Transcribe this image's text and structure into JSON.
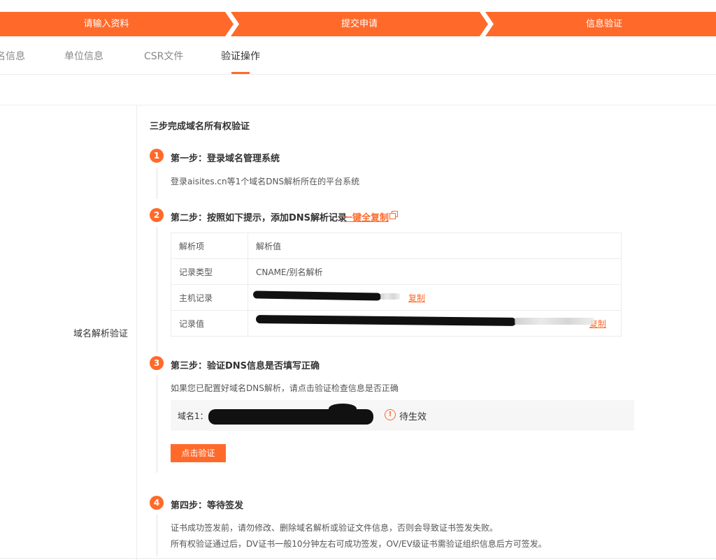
{
  "stepper": {
    "steps": [
      "请输入资料",
      "提交申请",
      "信息验证"
    ],
    "color": "#ff6a2b"
  },
  "tabs": [
    {
      "label": "名信息"
    },
    {
      "label": "单位信息"
    },
    {
      "label": "CSR文件"
    },
    {
      "label": "验证操作",
      "active": true
    }
  ],
  "side_label": "域名解析验证",
  "section_title": "三步完成域名所有权验证",
  "steps": [
    {
      "num": "1",
      "title": "第一步：登录域名管理系统",
      "desc": "登录aisites.cn等1个域名DNS解析所在的平台系统"
    },
    {
      "num": "2",
      "title": "第二步：按照如下提示，添加DNS解析记录",
      "copy_all": "一键全复制"
    },
    {
      "num": "3",
      "title": "第三步：验证DNS信息是否填写正确",
      "desc": "如果您已配置好域名DNS解析，请点击验证检查信息是否正确"
    },
    {
      "num": "4",
      "title": "第四步：等待签发",
      "desc1": "证书成功签发前，请勿修改、删除域名解析或验证文件信息，否则会导致证书签发失败。",
      "desc2": "所有权验证通过后，DV证书一般10分钟左右可成功签发，OV/EV级证书需验证组织信息后方可签发。"
    }
  ],
  "dns_table": {
    "header": {
      "key": "解析项",
      "value": "解析值"
    },
    "rows": [
      {
        "key": "记录类型",
        "value": "CNAME/别名解析"
      },
      {
        "key": "主机记录",
        "copy": "复制"
      },
      {
        "key": "记录值",
        "copy": "复制"
      }
    ]
  },
  "domain": {
    "label": "域名1：",
    "status_icon": "warning-circle-icon",
    "status": "待生效"
  },
  "verify_button": "点击验证"
}
